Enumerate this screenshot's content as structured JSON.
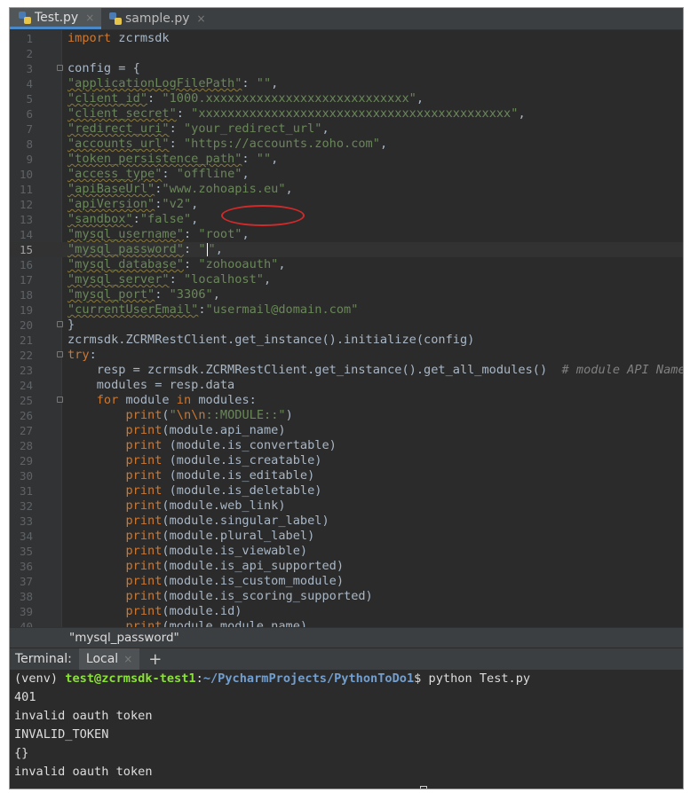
{
  "tabs": [
    {
      "label": "Test.py",
      "active": true
    },
    {
      "label": "sample.py",
      "active": false
    }
  ],
  "close_glyph": "×",
  "editor": {
    "current_line": 15,
    "lines": [
      {
        "n": "1",
        "t": "import zcrmsdk"
      },
      {
        "n": "2",
        "t": ""
      },
      {
        "n": "3",
        "t": "config = {"
      },
      {
        "n": "4",
        "t": "\"applicationLogFilePath\": \"\","
      },
      {
        "n": "5",
        "t": "\"client_id\": \"1000.xxxxxxxxxxxxxxxxxxxxxxxxxxxx\","
      },
      {
        "n": "6",
        "t": "\"client_secret\": \"xxxxxxxxxxxxxxxxxxxxxxxxxxxxxxxxxxxxxxxxxxx\","
      },
      {
        "n": "7",
        "t": "\"redirect_uri\": \"your_redirect_url\","
      },
      {
        "n": "8",
        "t": "\"accounts_url\": \"https://accounts.zoho.com\","
      },
      {
        "n": "9",
        "t": "\"token_persistence_path\": \"\","
      },
      {
        "n": "10",
        "t": "\"access_type\": \"offline\","
      },
      {
        "n": "11",
        "t": "\"apiBaseUrl\":\"www.zohoapis.eu\","
      },
      {
        "n": "12",
        "t": "\"apiVersion\":\"v2\","
      },
      {
        "n": "13",
        "t": "\"sandbox\":\"false\","
      },
      {
        "n": "14",
        "t": "\"mysql_username\": \"root\","
      },
      {
        "n": "15",
        "t": "\"mysql_password\": \"\","
      },
      {
        "n": "16",
        "t": "\"mysql_database\": \"zohooauth\","
      },
      {
        "n": "17",
        "t": "\"mysql_server\": \"localhost\","
      },
      {
        "n": "18",
        "t": "\"mysql_port\": \"3306\","
      },
      {
        "n": "19",
        "t": "\"currentUserEmail\":\"usermail@domain.com\""
      },
      {
        "n": "20",
        "t": "}"
      },
      {
        "n": "21",
        "t": "zcrmsdk.ZCRMRestClient.get_instance().initialize(config)"
      },
      {
        "n": "22",
        "t": "try:"
      },
      {
        "n": "23",
        "t": "    resp = zcrmsdk.ZCRMRestClient.get_instance().get_all_modules()  # module API Name"
      },
      {
        "n": "24",
        "t": "    modules = resp.data"
      },
      {
        "n": "25",
        "t": "    for module in modules:"
      },
      {
        "n": "26",
        "t": "        print(\"\\n\\n::MODULE::\")"
      },
      {
        "n": "27",
        "t": "        print(module.api_name)"
      },
      {
        "n": "28",
        "t": "        print (module.is_convertable)"
      },
      {
        "n": "29",
        "t": "        print (module.is_creatable)"
      },
      {
        "n": "30",
        "t": "        print (module.is_editable)"
      },
      {
        "n": "31",
        "t": "        print (module.is_deletable)"
      },
      {
        "n": "32",
        "t": "        print(module.web_link)"
      },
      {
        "n": "33",
        "t": "        print(module.singular_label)"
      },
      {
        "n": "34",
        "t": "        print(module.plural_label)"
      },
      {
        "n": "35",
        "t": "        print(module.is_viewable)"
      },
      {
        "n": "36",
        "t": "        print(module.is_api_supported)"
      },
      {
        "n": "37",
        "t": "        print(module.is_custom_module)"
      },
      {
        "n": "38",
        "t": "        print(module.is_scoring_supported)"
      },
      {
        "n": "39",
        "t": "        print(module.id)"
      },
      {
        "n": "40",
        "t": "        print(module.module_name)"
      }
    ]
  },
  "breadcrumb": "\"mysql_password\"",
  "terminal": {
    "title": "Terminal:",
    "tab_label": "Local",
    "add_glyph": "+",
    "prompt_prefix": "(venv) ",
    "prompt_user": "test@zcrmsdk-test1",
    "prompt_colon": ":",
    "prompt_path": "~/PycharmProjects/PythonToDo1",
    "prompt_symbol": "$ ",
    "command": "python Test.py",
    "output": [
      "401",
      "invalid oauth token",
      "INVALID_TOKEN",
      "{}",
      "invalid oauth token"
    ]
  },
  "colors": {
    "keyword": "#cc7832",
    "string": "#6a8759",
    "default": "#a9b7c6",
    "comment": "#808080",
    "annotation": "#d22a2a"
  }
}
